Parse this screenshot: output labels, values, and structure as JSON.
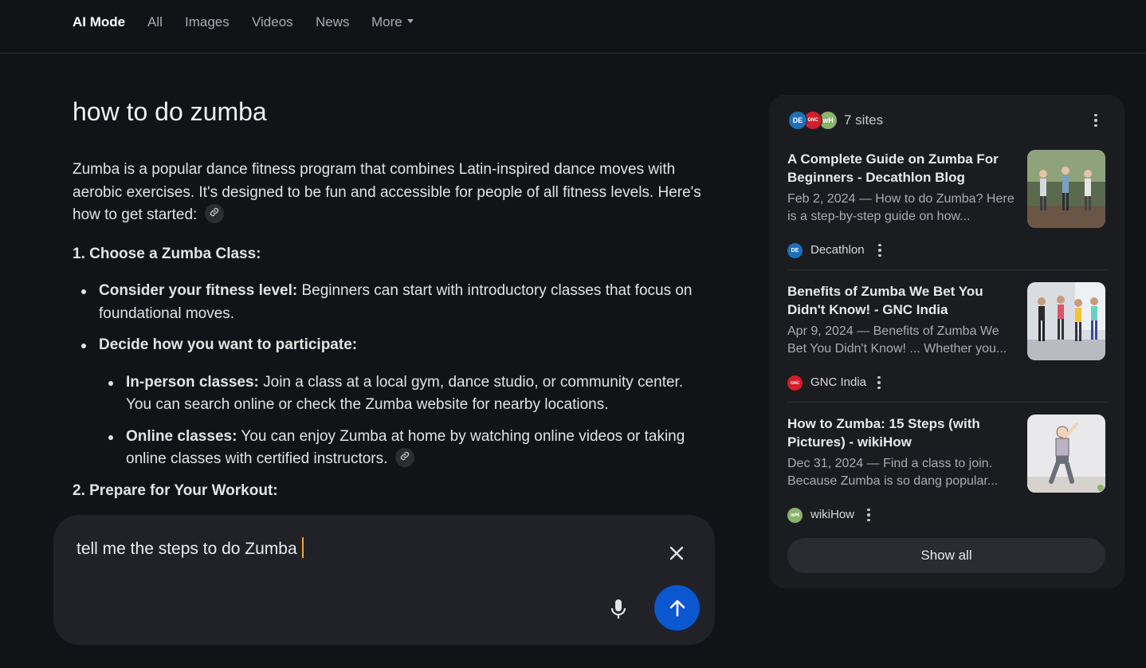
{
  "nav": {
    "tabs": [
      {
        "label": "AI Mode"
      },
      {
        "label": "All"
      },
      {
        "label": "Images"
      },
      {
        "label": "Videos"
      },
      {
        "label": "News"
      },
      {
        "label": "More"
      }
    ]
  },
  "query": {
    "title": "how to do zumba"
  },
  "answer": {
    "intro": "Zumba is a popular dance fitness program that combines Latin-inspired dance moves with aerobic exercises. It's designed to be fun and accessible for people of all fitness levels. Here's how to get started:",
    "section1_heading": "1. Choose a Zumba Class:",
    "bullets": [
      {
        "bold": "Consider your fitness level:",
        "text": " Beginners can start with introductory classes that focus on foundational moves."
      },
      {
        "bold": "Decide how you want to participate:",
        "text": ""
      }
    ],
    "sub_bullets": [
      {
        "bold": "In-person classes:",
        "text": " Join a class at a local gym, dance studio, or community center. You can search online or check the Zumba website for nearby locations."
      },
      {
        "bold": "Online classes:",
        "text": " You can enjoy Zumba at home by watching online videos or taking online classes with certified instructors."
      }
    ],
    "section2_heading": "2. Prepare for Your Workout:"
  },
  "composer": {
    "value": "tell me the steps to do Zumba"
  },
  "sources": {
    "count_label": "7 sites",
    "items": [
      {
        "title": "A Complete Guide on Zumba For Beginners - Decathlon Blog",
        "snippet": "Feb 2, 2024 — How to do Zumba? Here is a step-by-step guide on how...",
        "site": "Decathlon",
        "favicon_text": "DE"
      },
      {
        "title": "Benefits of Zumba We Bet You Didn't Know! - GNC India",
        "snippet": "Apr 9, 2024 — Benefits of Zumba We Bet You Didn't Know! ... Whether you...",
        "site": "GNC India",
        "favicon_text": "GNC"
      },
      {
        "title": "How to Zumba: 15 Steps (with Pictures) - wikiHow",
        "snippet": "Dec 31, 2024 — Find a class to join. Because Zumba is so dang popular...",
        "site": "wikiHow",
        "favicon_text": "wH"
      }
    ],
    "show_all_label": "Show all"
  },
  "icons": {
    "link": "link-icon",
    "close": "close-icon",
    "mic": "mic-icon",
    "send": "arrow-up-icon",
    "more": "more-vert-icon"
  },
  "colors": {
    "background": "#121316",
    "send_button": "#0b57d0",
    "cursor": "#f2a43a"
  }
}
